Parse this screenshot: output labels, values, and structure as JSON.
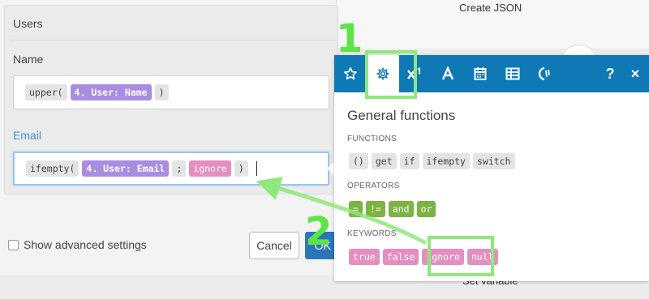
{
  "background": {
    "top_label": "Create JSON",
    "bottom_label": "Set variable"
  },
  "dialog": {
    "section_title": "Users",
    "name_field": {
      "label": "Name",
      "tokens": [
        "upper(",
        "4. User: Name",
        ")"
      ]
    },
    "email_field": {
      "label": "Email",
      "tokens": [
        "ifempty(",
        "4. User: Email",
        ";",
        "ignore",
        ")"
      ]
    },
    "show_advanced_label": "Show advanced settings",
    "cancel_label": "Cancel",
    "ok_label": "OK"
  },
  "popup": {
    "tabs": [
      "star-icon",
      "gear-icon",
      "superscript-icon",
      "text-icon",
      "calendar-icon",
      "table-icon",
      "hashtag-icon"
    ],
    "help_label": "?",
    "close_label": "×",
    "title": "General functions",
    "functions_label": "FUNCTIONS",
    "functions": [
      "()",
      "get",
      "if",
      "ifempty",
      "switch"
    ],
    "operators_label": "OPERATORS",
    "operators": [
      "=",
      "!=",
      "and",
      "or"
    ],
    "keywords_label": "KEYWORDS",
    "keywords": [
      "true",
      "false",
      "ignore",
      "null"
    ]
  },
  "annotations": {
    "step1": "1",
    "step2": "2",
    "color": "#5ee447"
  },
  "colors": {
    "tabbar": "#0f79b6",
    "function_chip": "#e4e4e4",
    "operator_chip": "#7cb342",
    "keyword_chip": "#e48fc0",
    "variable_chip": "#a98de3",
    "ok_button": "#2c76b8"
  }
}
